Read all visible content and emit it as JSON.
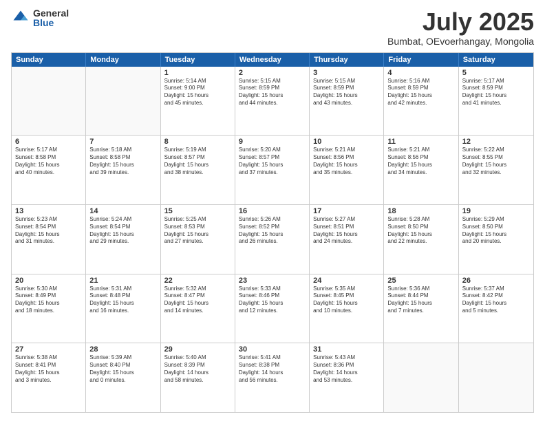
{
  "logo": {
    "general": "General",
    "blue": "Blue"
  },
  "title": "July 2025",
  "subtitle": "Bumbat, OEvoerhangay, Mongolia",
  "headers": [
    "Sunday",
    "Monday",
    "Tuesday",
    "Wednesday",
    "Thursday",
    "Friday",
    "Saturday"
  ],
  "rows": [
    [
      {
        "day": "",
        "lines": []
      },
      {
        "day": "",
        "lines": []
      },
      {
        "day": "1",
        "lines": [
          "Sunrise: 5:14 AM",
          "Sunset: 9:00 PM",
          "Daylight: 15 hours",
          "and 45 minutes."
        ]
      },
      {
        "day": "2",
        "lines": [
          "Sunrise: 5:15 AM",
          "Sunset: 8:59 PM",
          "Daylight: 15 hours",
          "and 44 minutes."
        ]
      },
      {
        "day": "3",
        "lines": [
          "Sunrise: 5:15 AM",
          "Sunset: 8:59 PM",
          "Daylight: 15 hours",
          "and 43 minutes."
        ]
      },
      {
        "day": "4",
        "lines": [
          "Sunrise: 5:16 AM",
          "Sunset: 8:59 PM",
          "Daylight: 15 hours",
          "and 42 minutes."
        ]
      },
      {
        "day": "5",
        "lines": [
          "Sunrise: 5:17 AM",
          "Sunset: 8:59 PM",
          "Daylight: 15 hours",
          "and 41 minutes."
        ]
      }
    ],
    [
      {
        "day": "6",
        "lines": [
          "Sunrise: 5:17 AM",
          "Sunset: 8:58 PM",
          "Daylight: 15 hours",
          "and 40 minutes."
        ]
      },
      {
        "day": "7",
        "lines": [
          "Sunrise: 5:18 AM",
          "Sunset: 8:58 PM",
          "Daylight: 15 hours",
          "and 39 minutes."
        ]
      },
      {
        "day": "8",
        "lines": [
          "Sunrise: 5:19 AM",
          "Sunset: 8:57 PM",
          "Daylight: 15 hours",
          "and 38 minutes."
        ]
      },
      {
        "day": "9",
        "lines": [
          "Sunrise: 5:20 AM",
          "Sunset: 8:57 PM",
          "Daylight: 15 hours",
          "and 37 minutes."
        ]
      },
      {
        "day": "10",
        "lines": [
          "Sunrise: 5:21 AM",
          "Sunset: 8:56 PM",
          "Daylight: 15 hours",
          "and 35 minutes."
        ]
      },
      {
        "day": "11",
        "lines": [
          "Sunrise: 5:21 AM",
          "Sunset: 8:56 PM",
          "Daylight: 15 hours",
          "and 34 minutes."
        ]
      },
      {
        "day": "12",
        "lines": [
          "Sunrise: 5:22 AM",
          "Sunset: 8:55 PM",
          "Daylight: 15 hours",
          "and 32 minutes."
        ]
      }
    ],
    [
      {
        "day": "13",
        "lines": [
          "Sunrise: 5:23 AM",
          "Sunset: 8:54 PM",
          "Daylight: 15 hours",
          "and 31 minutes."
        ]
      },
      {
        "day": "14",
        "lines": [
          "Sunrise: 5:24 AM",
          "Sunset: 8:54 PM",
          "Daylight: 15 hours",
          "and 29 minutes."
        ]
      },
      {
        "day": "15",
        "lines": [
          "Sunrise: 5:25 AM",
          "Sunset: 8:53 PM",
          "Daylight: 15 hours",
          "and 27 minutes."
        ]
      },
      {
        "day": "16",
        "lines": [
          "Sunrise: 5:26 AM",
          "Sunset: 8:52 PM",
          "Daylight: 15 hours",
          "and 26 minutes."
        ]
      },
      {
        "day": "17",
        "lines": [
          "Sunrise: 5:27 AM",
          "Sunset: 8:51 PM",
          "Daylight: 15 hours",
          "and 24 minutes."
        ]
      },
      {
        "day": "18",
        "lines": [
          "Sunrise: 5:28 AM",
          "Sunset: 8:50 PM",
          "Daylight: 15 hours",
          "and 22 minutes."
        ]
      },
      {
        "day": "19",
        "lines": [
          "Sunrise: 5:29 AM",
          "Sunset: 8:50 PM",
          "Daylight: 15 hours",
          "and 20 minutes."
        ]
      }
    ],
    [
      {
        "day": "20",
        "lines": [
          "Sunrise: 5:30 AM",
          "Sunset: 8:49 PM",
          "Daylight: 15 hours",
          "and 18 minutes."
        ]
      },
      {
        "day": "21",
        "lines": [
          "Sunrise: 5:31 AM",
          "Sunset: 8:48 PM",
          "Daylight: 15 hours",
          "and 16 minutes."
        ]
      },
      {
        "day": "22",
        "lines": [
          "Sunrise: 5:32 AM",
          "Sunset: 8:47 PM",
          "Daylight: 15 hours",
          "and 14 minutes."
        ]
      },
      {
        "day": "23",
        "lines": [
          "Sunrise: 5:33 AM",
          "Sunset: 8:46 PM",
          "Daylight: 15 hours",
          "and 12 minutes."
        ]
      },
      {
        "day": "24",
        "lines": [
          "Sunrise: 5:35 AM",
          "Sunset: 8:45 PM",
          "Daylight: 15 hours",
          "and 10 minutes."
        ]
      },
      {
        "day": "25",
        "lines": [
          "Sunrise: 5:36 AM",
          "Sunset: 8:44 PM",
          "Daylight: 15 hours",
          "and 7 minutes."
        ]
      },
      {
        "day": "26",
        "lines": [
          "Sunrise: 5:37 AM",
          "Sunset: 8:42 PM",
          "Daylight: 15 hours",
          "and 5 minutes."
        ]
      }
    ],
    [
      {
        "day": "27",
        "lines": [
          "Sunrise: 5:38 AM",
          "Sunset: 8:41 PM",
          "Daylight: 15 hours",
          "and 3 minutes."
        ]
      },
      {
        "day": "28",
        "lines": [
          "Sunrise: 5:39 AM",
          "Sunset: 8:40 PM",
          "Daylight: 15 hours",
          "and 0 minutes."
        ]
      },
      {
        "day": "29",
        "lines": [
          "Sunrise: 5:40 AM",
          "Sunset: 8:39 PM",
          "Daylight: 14 hours",
          "and 58 minutes."
        ]
      },
      {
        "day": "30",
        "lines": [
          "Sunrise: 5:41 AM",
          "Sunset: 8:38 PM",
          "Daylight: 14 hours",
          "and 56 minutes."
        ]
      },
      {
        "day": "31",
        "lines": [
          "Sunrise: 5:43 AM",
          "Sunset: 8:36 PM",
          "Daylight: 14 hours",
          "and 53 minutes."
        ]
      },
      {
        "day": "",
        "lines": []
      },
      {
        "day": "",
        "lines": []
      }
    ]
  ]
}
